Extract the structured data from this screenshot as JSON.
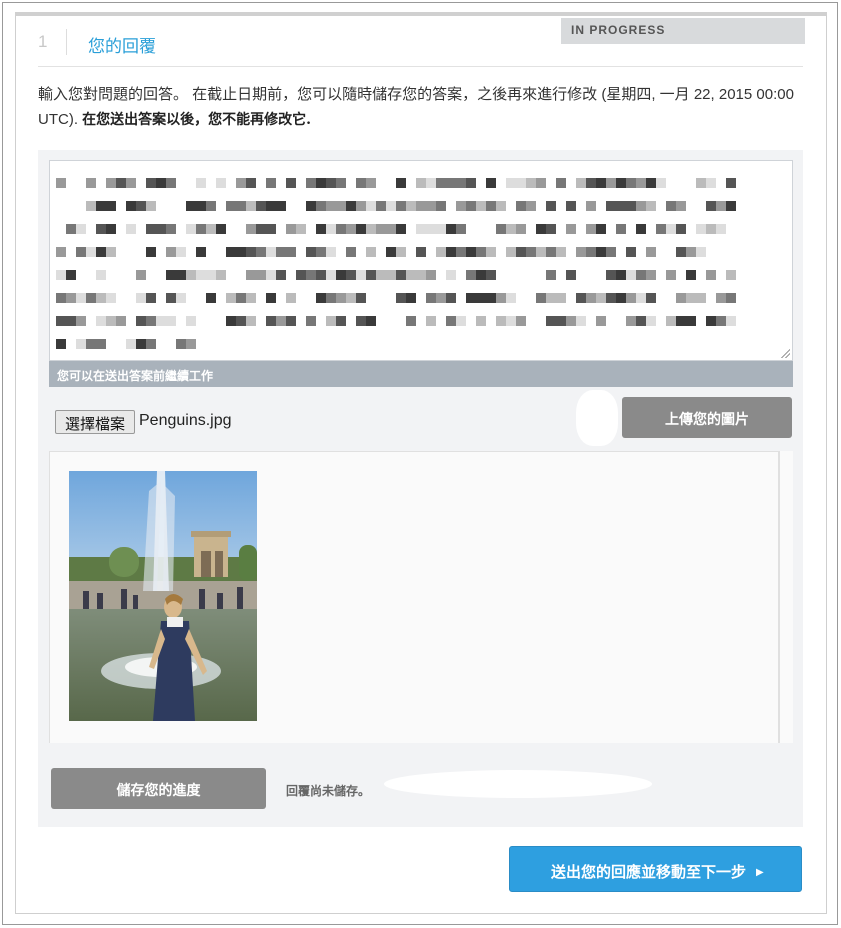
{
  "status": {
    "badge": "IN PROGRESS"
  },
  "section": {
    "number": "1",
    "title": "您的回覆"
  },
  "instructions": {
    "text": "輸入您對問題的回答。 在截止日期前，您可以隨時儲存您的答案，之後再來進行修改 (星期四, 一月 22, 2015 00:00 UTC). ",
    "emphasis": "在您送出答案以後，您不能再修改它."
  },
  "answer": {
    "hint": "您可以在送出答案前繼續工作"
  },
  "upload": {
    "choose_file_label": "選擇檔案",
    "file_name": "Penguins.jpg",
    "upload_button": "上傳您的圖片"
  },
  "uploaded_image": {
    "alt": "Penguins.jpg"
  },
  "progress": {
    "save_button": "儲存您的進度",
    "save_status": "回覆尚未儲存。"
  },
  "submit": {
    "label": "送出您的回應並移動至下一步",
    "arrow_icon": "caret-right-icon"
  },
  "colors": {
    "accent": "#2e9fe0",
    "title": "#2a9fd8",
    "disabled_button": "#8a8a8a"
  }
}
